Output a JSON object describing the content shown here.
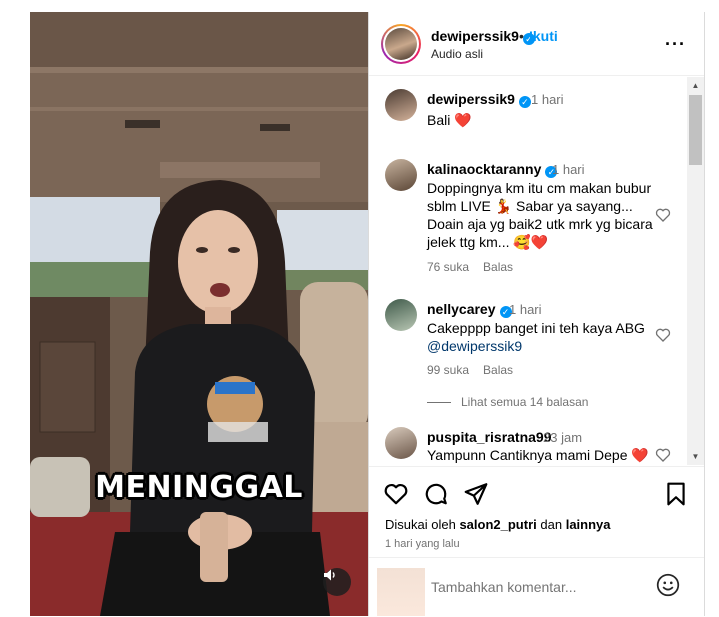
{
  "post": {
    "username": "dewiperssik9",
    "dot": "•",
    "follow_label": "Ikuti",
    "audio_label": "Audio asli",
    "more_icon": "more-horizontal-icon"
  },
  "media": {
    "overlay_caption": "MENINGGAL",
    "audio_icon": "speaker-icon"
  },
  "caption": {
    "username": "dewiperssik9",
    "time": "1 hari",
    "text": "Bali ❤️"
  },
  "comments": [
    {
      "username": "kalinaocktaranny",
      "time": "1 hari",
      "text": "Doppingnya km itu cm makan bubur sblm LIVE 💃 Sabar ya sayang... Doain aja yg baik2 utk mrk yg bicara jelek ttg km... 🥰❤️",
      "likes": "76 suka",
      "reply": "Balas"
    },
    {
      "username": "nellycarey",
      "time": "1 hari",
      "text": "Cakepppp banget ini teh kaya ABG",
      "mention": "@dewiperssik9",
      "likes": "99 suka",
      "reply": "Balas",
      "view_replies": "Lihat semua 14 balasan"
    },
    {
      "username": "puspita_risratna99",
      "time": "23 jam",
      "text": "Yampunn Cantiknya mami Depe ❤️"
    }
  ],
  "liked_by": {
    "prefix": "Disukai oleh",
    "user": "salon2_putri",
    "connector": "dan",
    "others": "lainnya"
  },
  "date": "1 hari yang lalu",
  "add_comment": {
    "placeholder": "Tambahkan komentar..."
  },
  "colors": {
    "accent": "#0095f6",
    "heart": "#ed4956",
    "muted": "#737373"
  }
}
